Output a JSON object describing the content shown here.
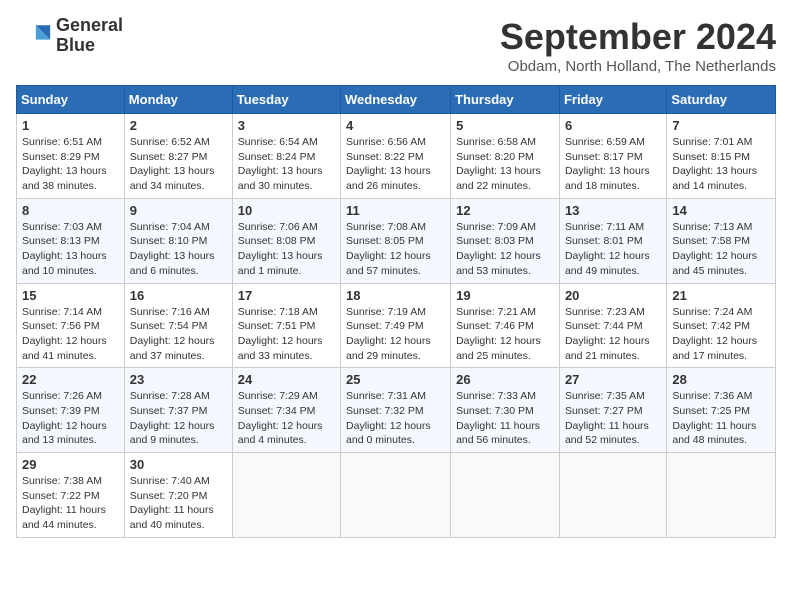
{
  "header": {
    "logo_line1": "General",
    "logo_line2": "Blue",
    "month_title": "September 2024",
    "location": "Obdam, North Holland, The Netherlands"
  },
  "days_of_week": [
    "Sunday",
    "Monday",
    "Tuesday",
    "Wednesday",
    "Thursday",
    "Friday",
    "Saturday"
  ],
  "weeks": [
    [
      {
        "day": 1,
        "text": "Sunrise: 6:51 AM\nSunset: 8:29 PM\nDaylight: 13 hours and 38 minutes."
      },
      {
        "day": 2,
        "text": "Sunrise: 6:52 AM\nSunset: 8:27 PM\nDaylight: 13 hours and 34 minutes."
      },
      {
        "day": 3,
        "text": "Sunrise: 6:54 AM\nSunset: 8:24 PM\nDaylight: 13 hours and 30 minutes."
      },
      {
        "day": 4,
        "text": "Sunrise: 6:56 AM\nSunset: 8:22 PM\nDaylight: 13 hours and 26 minutes."
      },
      {
        "day": 5,
        "text": "Sunrise: 6:58 AM\nSunset: 8:20 PM\nDaylight: 13 hours and 22 minutes."
      },
      {
        "day": 6,
        "text": "Sunrise: 6:59 AM\nSunset: 8:17 PM\nDaylight: 13 hours and 18 minutes."
      },
      {
        "day": 7,
        "text": "Sunrise: 7:01 AM\nSunset: 8:15 PM\nDaylight: 13 hours and 14 minutes."
      }
    ],
    [
      {
        "day": 8,
        "text": "Sunrise: 7:03 AM\nSunset: 8:13 PM\nDaylight: 13 hours and 10 minutes."
      },
      {
        "day": 9,
        "text": "Sunrise: 7:04 AM\nSunset: 8:10 PM\nDaylight: 13 hours and 6 minutes."
      },
      {
        "day": 10,
        "text": "Sunrise: 7:06 AM\nSunset: 8:08 PM\nDaylight: 13 hours and 1 minute."
      },
      {
        "day": 11,
        "text": "Sunrise: 7:08 AM\nSunset: 8:05 PM\nDaylight: 12 hours and 57 minutes."
      },
      {
        "day": 12,
        "text": "Sunrise: 7:09 AM\nSunset: 8:03 PM\nDaylight: 12 hours and 53 minutes."
      },
      {
        "day": 13,
        "text": "Sunrise: 7:11 AM\nSunset: 8:01 PM\nDaylight: 12 hours and 49 minutes."
      },
      {
        "day": 14,
        "text": "Sunrise: 7:13 AM\nSunset: 7:58 PM\nDaylight: 12 hours and 45 minutes."
      }
    ],
    [
      {
        "day": 15,
        "text": "Sunrise: 7:14 AM\nSunset: 7:56 PM\nDaylight: 12 hours and 41 minutes."
      },
      {
        "day": 16,
        "text": "Sunrise: 7:16 AM\nSunset: 7:54 PM\nDaylight: 12 hours and 37 minutes."
      },
      {
        "day": 17,
        "text": "Sunrise: 7:18 AM\nSunset: 7:51 PM\nDaylight: 12 hours and 33 minutes."
      },
      {
        "day": 18,
        "text": "Sunrise: 7:19 AM\nSunset: 7:49 PM\nDaylight: 12 hours and 29 minutes."
      },
      {
        "day": 19,
        "text": "Sunrise: 7:21 AM\nSunset: 7:46 PM\nDaylight: 12 hours and 25 minutes."
      },
      {
        "day": 20,
        "text": "Sunrise: 7:23 AM\nSunset: 7:44 PM\nDaylight: 12 hours and 21 minutes."
      },
      {
        "day": 21,
        "text": "Sunrise: 7:24 AM\nSunset: 7:42 PM\nDaylight: 12 hours and 17 minutes."
      }
    ],
    [
      {
        "day": 22,
        "text": "Sunrise: 7:26 AM\nSunset: 7:39 PM\nDaylight: 12 hours and 13 minutes."
      },
      {
        "day": 23,
        "text": "Sunrise: 7:28 AM\nSunset: 7:37 PM\nDaylight: 12 hours and 9 minutes."
      },
      {
        "day": 24,
        "text": "Sunrise: 7:29 AM\nSunset: 7:34 PM\nDaylight: 12 hours and 4 minutes."
      },
      {
        "day": 25,
        "text": "Sunrise: 7:31 AM\nSunset: 7:32 PM\nDaylight: 12 hours and 0 minutes."
      },
      {
        "day": 26,
        "text": "Sunrise: 7:33 AM\nSunset: 7:30 PM\nDaylight: 11 hours and 56 minutes."
      },
      {
        "day": 27,
        "text": "Sunrise: 7:35 AM\nSunset: 7:27 PM\nDaylight: 11 hours and 52 minutes."
      },
      {
        "day": 28,
        "text": "Sunrise: 7:36 AM\nSunset: 7:25 PM\nDaylight: 11 hours and 48 minutes."
      }
    ],
    [
      {
        "day": 29,
        "text": "Sunrise: 7:38 AM\nSunset: 7:22 PM\nDaylight: 11 hours and 44 minutes."
      },
      {
        "day": 30,
        "text": "Sunrise: 7:40 AM\nSunset: 7:20 PM\nDaylight: 11 hours and 40 minutes."
      },
      null,
      null,
      null,
      null,
      null
    ]
  ]
}
